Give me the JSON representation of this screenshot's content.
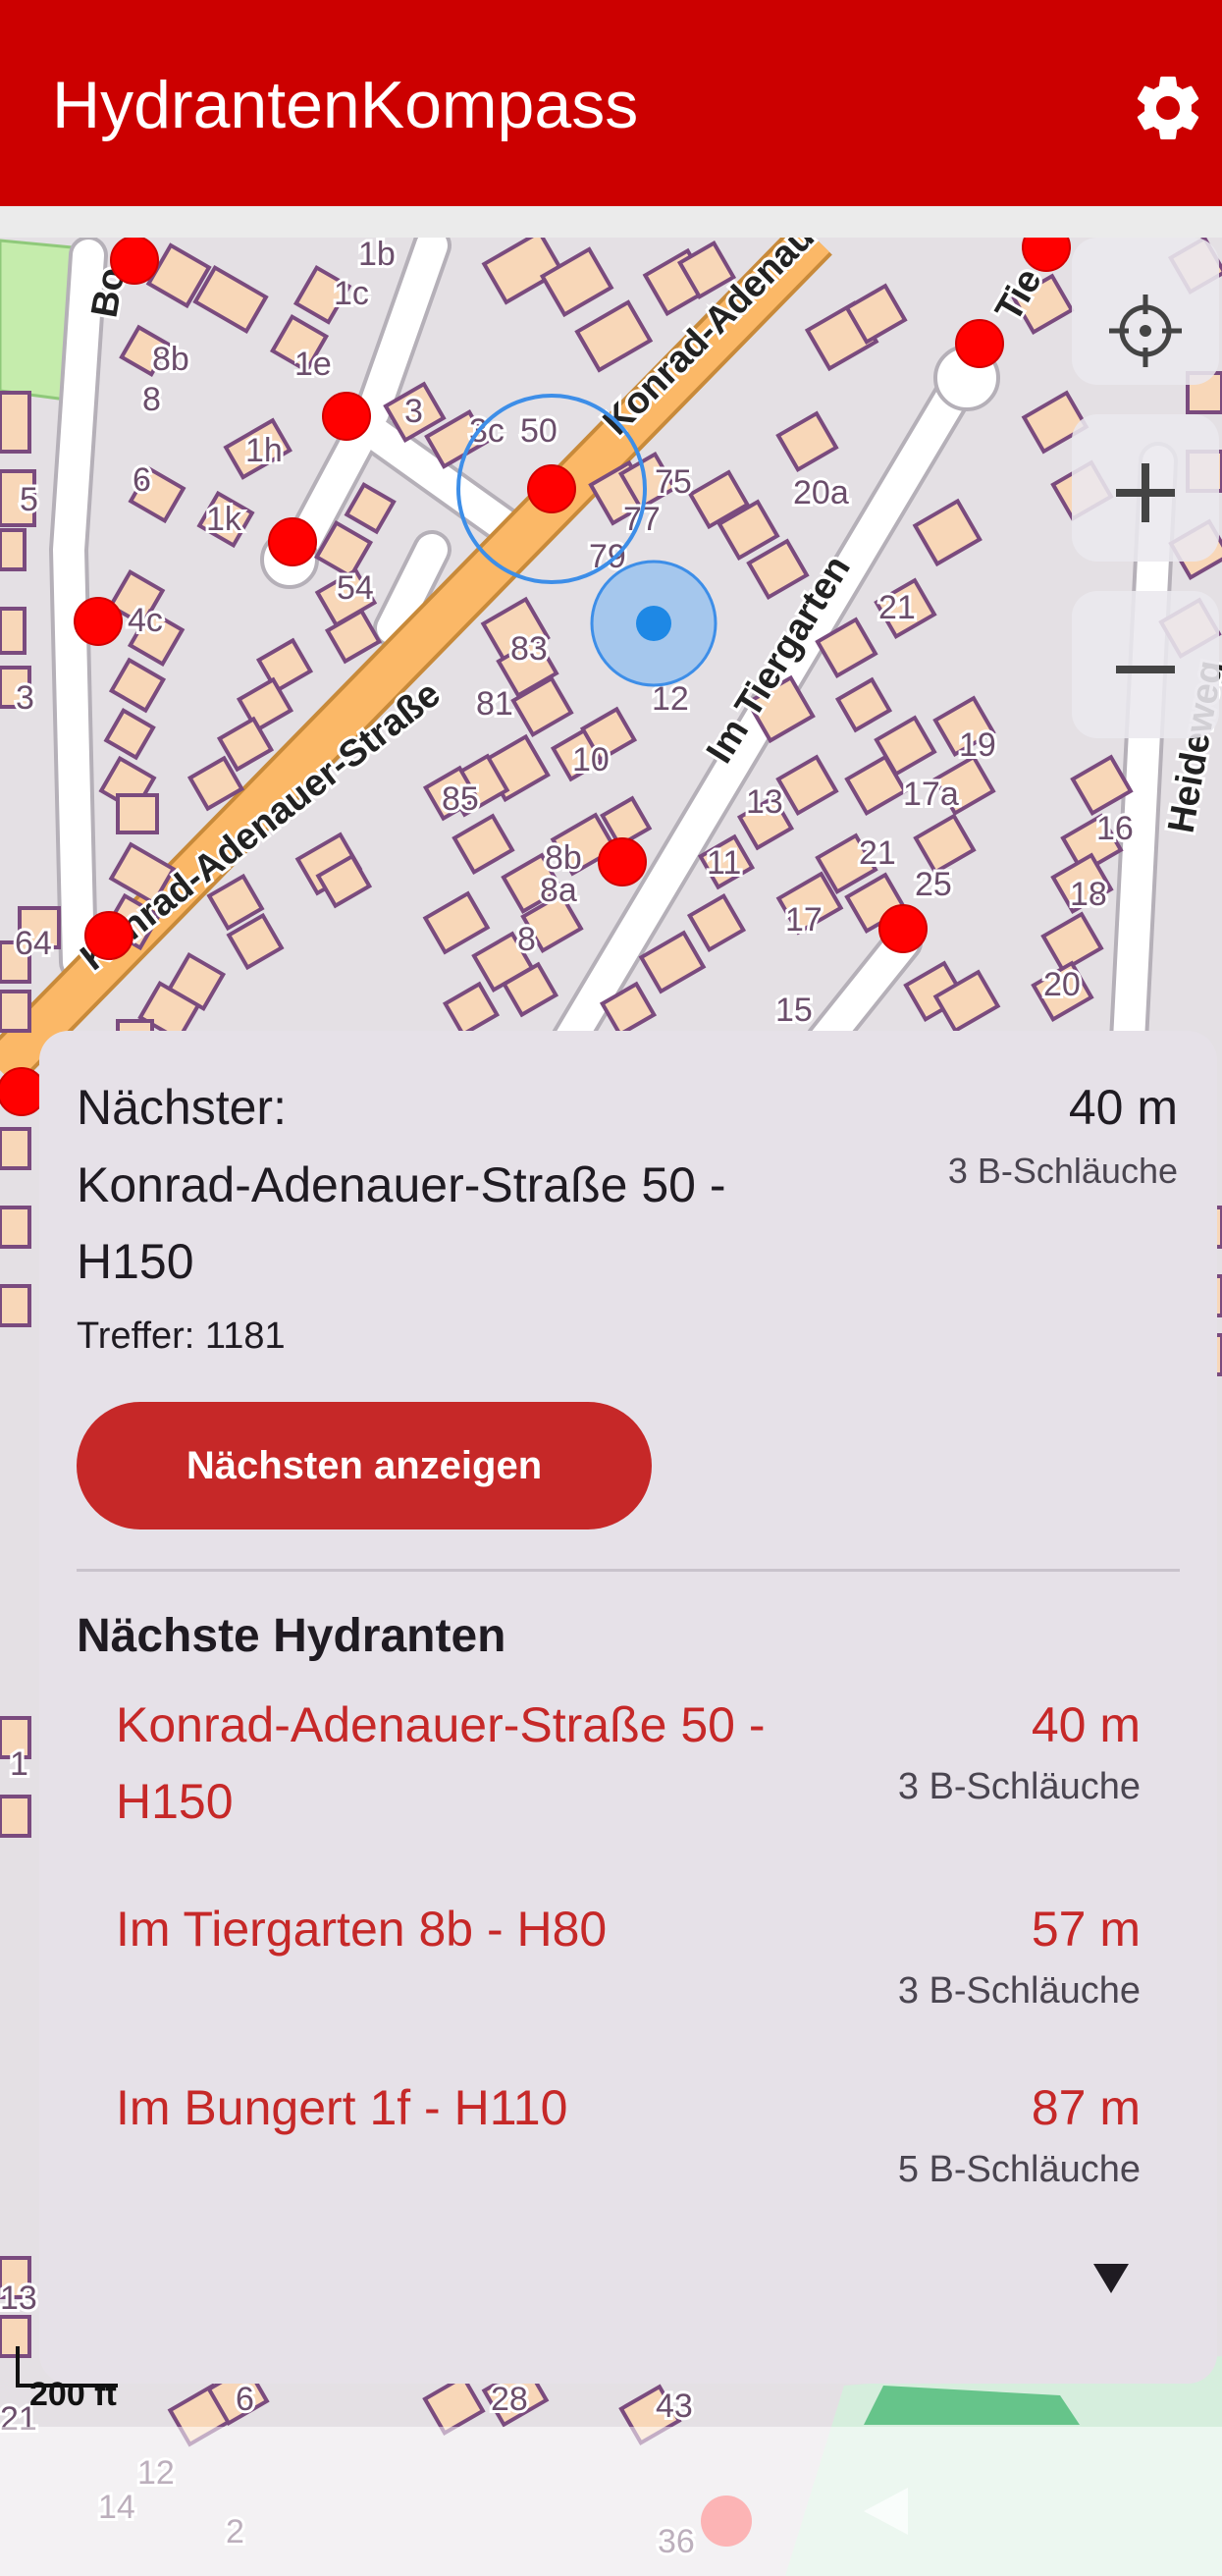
{
  "app": {
    "title": "HydrantenKompass",
    "brand_color": "#cc0000",
    "settings_icon": "gear-icon"
  },
  "map": {
    "street_labels": [
      "Konrad-Adenauer-Straße",
      "Konrad-Adenauer-Straße",
      "Im Tiergarten",
      "Heideweg",
      "Bo",
      "Tie"
    ],
    "house_numbers": [
      "1b",
      "1c",
      "8b",
      "8",
      "1e",
      "3",
      "3c",
      "50",
      "75",
      "77",
      "79",
      "20a",
      "1h",
      "6",
      "1k",
      "54",
      "4c",
      "83",
      "81",
      "3",
      "5",
      "12",
      "21",
      "10",
      "85",
      "13",
      "19",
      "17a",
      "16",
      "18",
      "21",
      "25",
      "11",
      "8b",
      "8a",
      "8",
      "17",
      "64",
      "20",
      "15",
      "13",
      "28",
      "43",
      "14",
      "12",
      "2",
      "36",
      "1",
      "6",
      "21"
    ],
    "scale_label": "200 ft",
    "controls": {
      "locate_icon": "crosshair-icon",
      "zoom_in_icon": "plus-icon",
      "zoom_out_icon": "minus-icon"
    },
    "hydrant_color": "#ff0000",
    "location_color": "#1e88e5"
  },
  "nearest": {
    "label": "Nächster:",
    "name": "Konrad-Adenauer-Straße 50 - H150",
    "distance": "40 m",
    "hoses": "3 B-Schläuche",
    "hits": "Treffer: 1181",
    "button": "Nächsten anzeigen"
  },
  "list": {
    "title": "Nächste Hydranten",
    "items": [
      {
        "name": "Konrad-Adenauer-Straße 50 - H150",
        "distance": "40 m",
        "hoses": "3 B-Schläuche"
      },
      {
        "name": "Im Tiergarten 8b - H80",
        "distance": "57 m",
        "hoses": "3 B-Schläuche"
      },
      {
        "name": "Im Bungert 1f - H110",
        "distance": "87 m",
        "hoses": "5 B-Schläuche"
      }
    ],
    "more_icon": "triangle-down-icon"
  },
  "system_nav": {
    "back_icon": "back-triangle-icon"
  }
}
